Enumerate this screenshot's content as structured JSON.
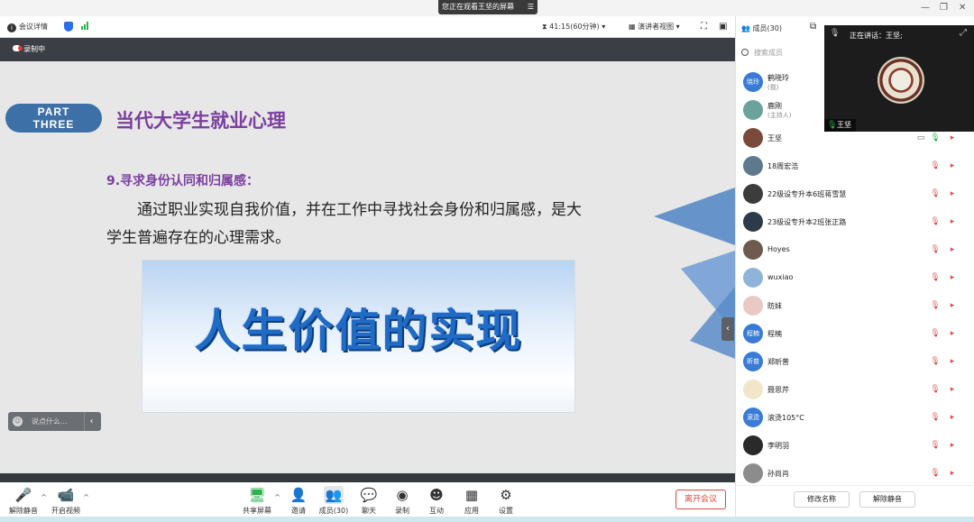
{
  "window": {
    "share_notice": "您正在观看王坚的屏幕",
    "minimize": "—",
    "restore": "❐",
    "close": "✕"
  },
  "infobar": {
    "meeting_info": "会议详情",
    "timer": "41:15(60分钟)",
    "view_mode": "演讲者视图"
  },
  "recording": {
    "label": "录制中"
  },
  "slide": {
    "part_line1": "PART",
    "part_line2": "THREE",
    "title": "当代大学生就业心理",
    "section_heading": "9.寻求身份认同和归属感：",
    "body": "通过职业实现自我价值，并在工作中寻找社会身份和归属感，是大学生普遍存在的心理需求。",
    "banner_text": "人生价值的实现"
  },
  "chat": {
    "placeholder": "说点什么..."
  },
  "controls": {
    "unmute": "解除静音",
    "start_video": "开启视频",
    "share_screen": "共享屏幕",
    "invite": "邀请",
    "members": "成员(30)",
    "chat": "聊天",
    "record": "录制",
    "interact": "互动",
    "apps": "应用",
    "settings": "设置",
    "leave": "离开会议"
  },
  "panel": {
    "title": "成员(30)",
    "search_placeholder": "搜索成员",
    "members": [
      {
        "name": "鹤晓玲",
        "sub": "(我)",
        "avatar_text": "晓玲",
        "avatar_color": "#3a7bd5"
      },
      {
        "name": "鹿刚",
        "sub": "(主持人)",
        "avatar_text": "",
        "avatar_color": "#6aa39a"
      },
      {
        "name": "王坚",
        "sub": "",
        "avatar_text": "",
        "avatar_color": "#7a4b3a"
      },
      {
        "name": "18周宏浩",
        "sub": "",
        "avatar_text": "",
        "avatar_color": "#5d7a8c"
      },
      {
        "name": "22级设专升本6班蒋雪慧",
        "sub": "",
        "avatar_text": "",
        "avatar_color": "#3c3c3c"
      },
      {
        "name": "23级设专升本2班张正路",
        "sub": "",
        "avatar_text": "",
        "avatar_color": "#2d3a4a"
      },
      {
        "name": "Hoyes",
        "sub": "",
        "avatar_text": "",
        "avatar_color": "#6f5a4e"
      },
      {
        "name": "wuxiao",
        "sub": "",
        "avatar_text": "",
        "avatar_color": "#8fb4d9"
      },
      {
        "name": "昉妹",
        "sub": "",
        "avatar_text": "",
        "avatar_color": "#e8c9c4"
      },
      {
        "name": "程楠",
        "sub": "",
        "avatar_text": "程楠",
        "avatar_color": "#3a7bd5"
      },
      {
        "name": "郑昕普",
        "sub": "",
        "avatar_text": "昕普",
        "avatar_color": "#3a7bd5"
      },
      {
        "name": "聂思芹",
        "sub": "",
        "avatar_text": "",
        "avatar_color": "#f1e6c8"
      },
      {
        "name": "滚烫105°C",
        "sub": "",
        "avatar_text": "滚烫",
        "avatar_color": "#3a7bd5"
      },
      {
        "name": "李明羽",
        "sub": "",
        "avatar_text": "",
        "avatar_color": "#2a2a2a"
      },
      {
        "name": "孙尚肖",
        "sub": "",
        "avatar_text": "",
        "avatar_color": "#8c8c8c"
      }
    ],
    "rename_button": "修改名称",
    "unmute_all_button": "解除静音"
  },
  "video": {
    "speaking_label": "正在讲话：王坚;",
    "name_tag": "王坚"
  }
}
